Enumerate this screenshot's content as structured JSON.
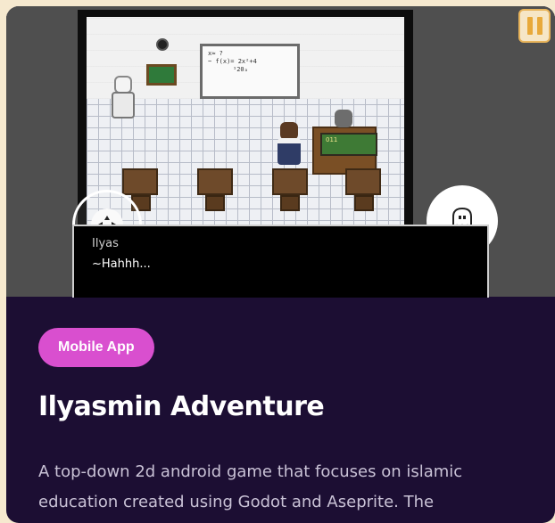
{
  "game": {
    "dialog": {
      "speaker": "Ilyas",
      "line": "~Hahhh..."
    },
    "whiteboard_text": [
      "x≈ ?",
      "~ f(x)= 2x²+4",
      "¹20ₐ"
    ],
    "teacher_board_text": "011",
    "controls": {
      "dpad_icon": "dpad-icon",
      "action_icon": "ghost-icon",
      "pause_icon": "pause-icon"
    }
  },
  "card": {
    "badge": "Mobile App",
    "title": "Ilyasmin Adventure",
    "description": "A top-down 2d android game that focuses on islamic education created using Godot and Aseprite. The"
  },
  "colors": {
    "page_bg": "#f6e9cf",
    "card_bg": "#1c0e33",
    "badge_bg": "#d94fcf",
    "title": "#ffffff",
    "description": "#c9c2d6",
    "pause_accent": "#e8a93a"
  }
}
